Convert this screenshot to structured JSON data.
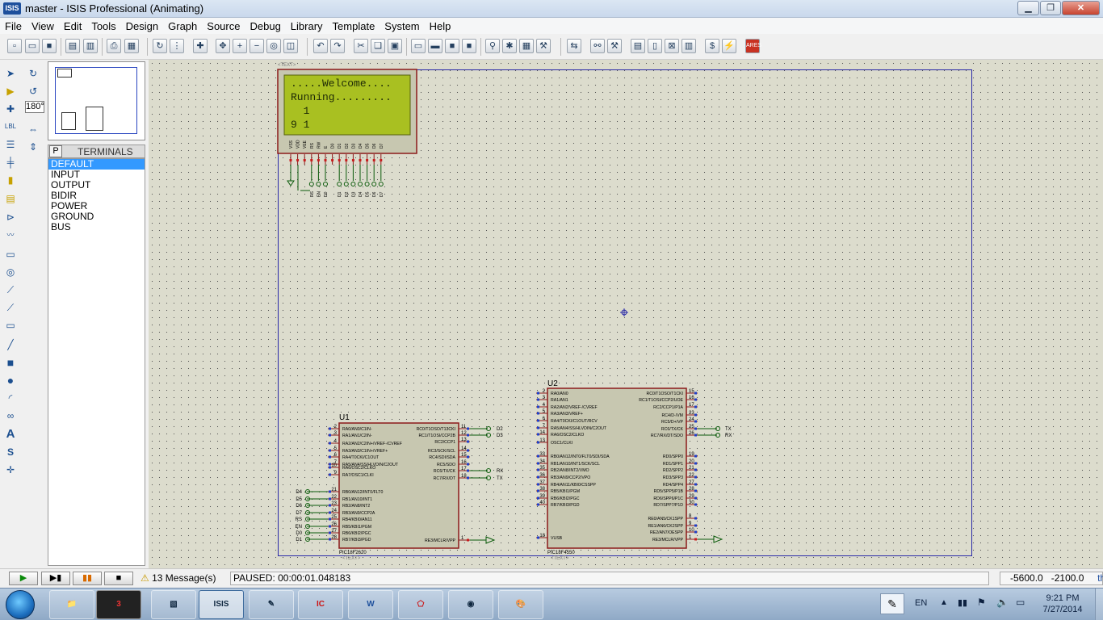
{
  "window": {
    "app_icon": "ISIS",
    "title": "master - ISIS Professional (Animating)"
  },
  "menu": [
    "File",
    "View",
    "Edit",
    "Tools",
    "Design",
    "Graph",
    "Source",
    "Debug",
    "Library",
    "Template",
    "System",
    "Help"
  ],
  "angle_field": "180°",
  "terminals": {
    "tab": "P",
    "header": "TERMINALS",
    "items": [
      "DEFAULT",
      "INPUT",
      "OUTPUT",
      "BIDIR",
      "POWER",
      "GROUND",
      "BUS"
    ],
    "selected": "DEFAULT"
  },
  "schematic": {
    "sheet_text_tag": "<TEXT>",
    "lcd": {
      "line1": ".....Welcome....",
      "line2": "Running.........",
      "line3": "  1",
      "line4": "9 1",
      "pins": [
        "VSS",
        "VDD",
        "VEE",
        "RS",
        "RW",
        "E",
        "D0",
        "D1",
        "D2",
        "D3",
        "D4",
        "D5",
        "D6",
        "D7"
      ],
      "bus_labels": [
        "RS",
        "EN",
        "D0",
        "D1",
        "D2",
        "D3",
        "D4",
        "D5",
        "D6",
        "D7"
      ]
    },
    "u1": {
      "ref": "U1",
      "part": "PIC18F2620",
      "text_tag": "<TEXT>",
      "left_pins": [
        {
          "num": "2",
          "name": "RA0/AN0/C1IN-"
        },
        {
          "num": "3",
          "name": "RA1/AN1/C2IN-"
        },
        {
          "num": "4",
          "name": "RA2/AN2/C2IN+/VREF-/CVREF"
        },
        {
          "num": "5",
          "name": "RA3/AN3/C1IN+/VREF+"
        },
        {
          "num": "6",
          "name": "RA4/T0CKI/C1OUT"
        },
        {
          "num": "7",
          "name": "RA5/AN4/SS/HLVDIN/C2OUT"
        },
        {
          "num": "10",
          "name": "RA6/OSC2/CLKO"
        },
        {
          "num": "9",
          "name": "RA7/OSC1/CLKI"
        },
        {
          "num": "21",
          "name": "RB0/AN12/INT0/FLT0"
        },
        {
          "num": "22",
          "name": "RB1/AN10/INT1"
        },
        {
          "num": "23",
          "name": "RB2/AN8/INT2"
        },
        {
          "num": "24",
          "name": "RB3/AN9/CCP2A"
        },
        {
          "num": "25",
          "name": "RB4/KBI0/AN11"
        },
        {
          "num": "26",
          "name": "RB5/KBI1/PGM"
        },
        {
          "num": "27",
          "name": "RB6/KBI2/PGC"
        },
        {
          "num": "28",
          "name": "RB7/KBI3/PGD"
        }
      ],
      "right_pins": [
        {
          "num": "11",
          "name": "RC0/T1OSO/T13CKI"
        },
        {
          "num": "12",
          "name": "RC1/T1OSI/CCP2B"
        },
        {
          "num": "13",
          "name": "RC2/CCP1"
        },
        {
          "num": "14",
          "name": "RC3/SCK/SCL"
        },
        {
          "num": "15",
          "name": "RC4/SDI/SDA"
        },
        {
          "num": "16",
          "name": "RC5/SDO"
        },
        {
          "num": "17",
          "name": "RC6/TX/CK"
        },
        {
          "num": "18",
          "name": "RC7/RX/DT"
        },
        {
          "num": "1",
          "name": "RE3/MCLR/VPP"
        }
      ],
      "left_labels": [
        "D4",
        "D5",
        "D6",
        "D7",
        "RS",
        "EN",
        "D0",
        "D1"
      ],
      "right_labels": [
        "D2",
        "D3",
        "RX",
        "TX"
      ]
    },
    "u2": {
      "ref": "U2",
      "part": "PIC18F4550",
      "text_tag": "<TEXT>",
      "left_pins": [
        {
          "num": "2",
          "name": "RA0/AN0"
        },
        {
          "num": "3",
          "name": "RA1/AN1"
        },
        {
          "num": "4",
          "name": "RA2/AN2/VREF-/CVREF"
        },
        {
          "num": "5",
          "name": "RA3/AN3/VREF+"
        },
        {
          "num": "6",
          "name": "RA4/T0CKI/C1OUT/RCV"
        },
        {
          "num": "7",
          "name": "RA5/AN4/SS/HLVDIN/C2OUT"
        },
        {
          "num": "14",
          "name": "RA6/OSC2/CLKO"
        },
        {
          "num": "13",
          "name": "OSC1/CLKI"
        },
        {
          "num": "33",
          "name": "RB0/AN12/INT0/FLT0/SDI/SDA"
        },
        {
          "num": "34",
          "name": "RB1/AN10/INT1/SCK/SCL"
        },
        {
          "num": "35",
          "name": "RB2/AN8/INT2/VMO"
        },
        {
          "num": "36",
          "name": "RB3/AN9/CCP2/VPO"
        },
        {
          "num": "37",
          "name": "RB4/AN11/KBI0/CSSPP"
        },
        {
          "num": "38",
          "name": "RB5/KBI1/PGM"
        },
        {
          "num": "39",
          "name": "RB6/KBI2/PGC"
        },
        {
          "num": "40",
          "name": "RB7/KBI3/PGD"
        },
        {
          "num": "18",
          "name": "VUSB"
        }
      ],
      "right_pins": [
        {
          "num": "15",
          "name": "RC0/T1OSO/T1CKI"
        },
        {
          "num": "16",
          "name": "RC1/T1OSI/CCP2/UOE"
        },
        {
          "num": "17",
          "name": "RC2/CCP1/P1A"
        },
        {
          "num": "23",
          "name": "RC4/D-/VM"
        },
        {
          "num": "24",
          "name": "RC5/D+/VP"
        },
        {
          "num": "25",
          "name": "RC6/TX/CK"
        },
        {
          "num": "26",
          "name": "RC7/RX/DT/SDO"
        },
        {
          "num": "19",
          "name": "RD0/SPP0"
        },
        {
          "num": "20",
          "name": "RD1/SPP1"
        },
        {
          "num": "21",
          "name": "RD2/SPP2"
        },
        {
          "num": "22",
          "name": "RD3/SPP3"
        },
        {
          "num": "27",
          "name": "RD4/SPP4"
        },
        {
          "num": "28",
          "name": "RD5/SPP5/P1B"
        },
        {
          "num": "29",
          "name": "RD6/SPP6/P1C"
        },
        {
          "num": "30",
          "name": "RD7/SPP7/P1D"
        },
        {
          "num": "8",
          "name": "RE0/AN5/CK1SPP"
        },
        {
          "num": "9",
          "name": "RE1/AN6/CK2SPP"
        },
        {
          "num": "10",
          "name": "RE2/AN7/OESPP"
        },
        {
          "num": "1",
          "name": "RE3/MCLR/VPP"
        }
      ],
      "right_labels": [
        "TX",
        "RX"
      ]
    }
  },
  "status": {
    "messages": "13 Message(s)",
    "sim_state": "PAUSED: 00:00:01.048183",
    "coord_x": "-5600.0",
    "coord_y": "-2100.0",
    "units": "th"
  },
  "taskbar": {
    "tasks": [
      "explorer",
      "display",
      "photo",
      "ISIS",
      "notepad",
      "ic",
      "word",
      "pdf",
      "chrome",
      "paint"
    ],
    "language": "EN",
    "time": "9:21 PM",
    "date": "7/27/2014"
  },
  "colors": {
    "lcd_background": "#a9c021",
    "chip_body": "#c7c7b0",
    "chip_border": "#8b1a1a",
    "wire": "#0a5a0a",
    "sheet_border": "#2a2aa8",
    "canvas": "#dcdccd"
  }
}
